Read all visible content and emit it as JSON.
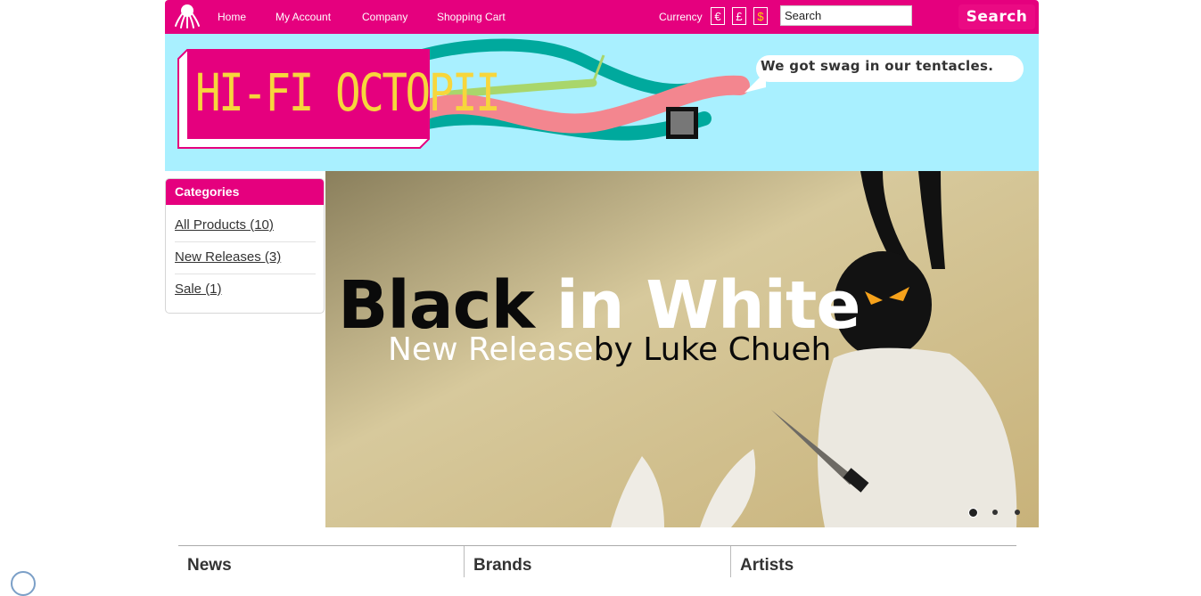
{
  "nav": {
    "items": [
      "Home",
      "My Account",
      "Company",
      "Shopping Cart"
    ],
    "currency_label": "Currency",
    "currencies": [
      "€",
      "£",
      "$"
    ],
    "search_placeholder": "Search",
    "search_button": "Search"
  },
  "banner": {
    "logo_text": "HI-FI OCTOPII",
    "tagline": "We got swag in our tentacles."
  },
  "sidebar": {
    "heading": "Categories",
    "items": [
      {
        "label": "All Products (10)"
      },
      {
        "label": "New Releases (3)"
      },
      {
        "label": "Sale (1)"
      }
    ]
  },
  "hero": {
    "title_black": "Black",
    "title_white": "in White",
    "sub_white": "New Release",
    "sub_black": "by Luke Chueh",
    "slide_count": 3,
    "active_slide": 1
  },
  "bottom": {
    "columns": [
      "News",
      "Brands",
      "Artists"
    ]
  },
  "colors": {
    "brand_pink": "#e5007e",
    "banner_sky": "#a9f0ff",
    "tentacle_teal": "#00a99d",
    "tentacle_pink": "#f3868f",
    "logo_yellow": "#f7d63c"
  }
}
